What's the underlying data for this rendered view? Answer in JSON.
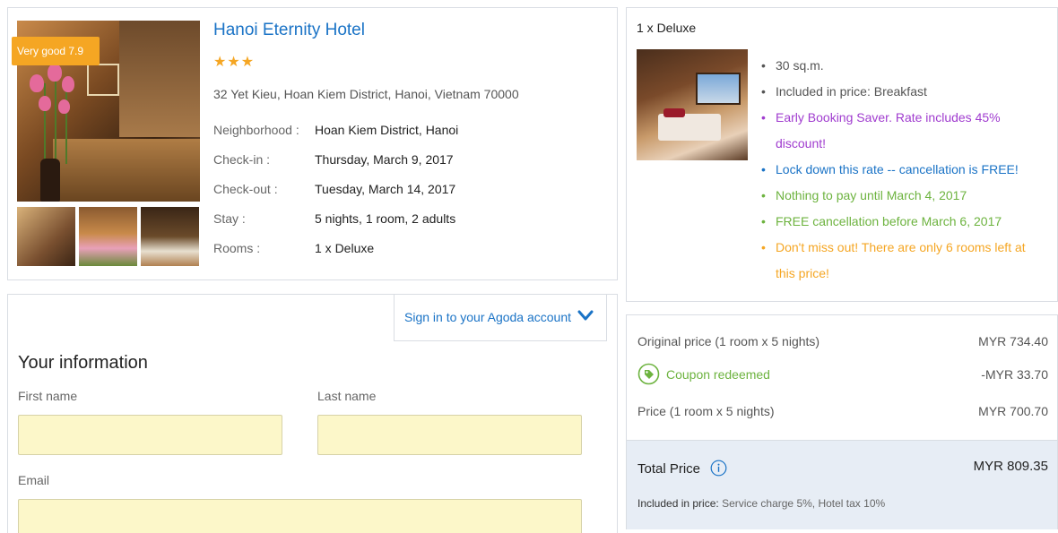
{
  "hotel": {
    "score_badge": "Very good 7.9",
    "name": "Hanoi Eternity Hotel",
    "stars": "★★★",
    "star_rating": 3,
    "address": "32 Yet Kieu, Hoan Kiem District, Hanoi, Vietnam 70000",
    "details": [
      {
        "label": "Neighborhood :",
        "value": "Hoan Kiem District, Hanoi"
      },
      {
        "label": "Check-in :",
        "value": "Thursday, March 9, 2017"
      },
      {
        "label": "Check-out :",
        "value": "Tuesday, March 14, 2017"
      },
      {
        "label": "Stay :",
        "value": "5 nights, 1 room, 2 adults"
      },
      {
        "label": "Rooms :",
        "value": "1 x Deluxe"
      }
    ]
  },
  "room": {
    "title": "1 x Deluxe",
    "features": [
      {
        "text": "30 sq.m.",
        "color": "#555555"
      },
      {
        "text": "Included in price: Breakfast",
        "color": "#555555"
      },
      {
        "text": "Early Booking Saver. Rate includes 45% discount!",
        "color": "#a03ccf"
      },
      {
        "text": "Lock down this rate -- cancellation is FREE!",
        "color": "#1a73c6"
      },
      {
        "text": "Nothing to pay until March 4, 2017",
        "color": "#6db33f"
      },
      {
        "text": "FREE cancellation before March 6, 2017",
        "color": "#6db33f"
      },
      {
        "text": "Don't miss out! There are only 6 rooms left at this price!",
        "color": "#f5a623"
      }
    ]
  },
  "form": {
    "signin_label": "Sign in to your Agoda account",
    "title": "Your information",
    "first_name_label": "First name",
    "last_name_label": "Last name",
    "email_label": "Email",
    "first_name_value": "",
    "last_name_value": "",
    "email_value": ""
  },
  "price": {
    "original_label": "Original price (1 room x 5 nights)",
    "original_value": "MYR 734.40",
    "coupon_label": "Coupon redeemed",
    "coupon_value": "-MYR 33.70",
    "price_label": "Price (1 room x 5 nights)",
    "price_value": "MYR 700.70",
    "total_label": "Total Price",
    "total_value": "MYR 809.35",
    "included_label": "Included in price:",
    "included_value": " Service charge 5%, Hotel tax 10%"
  },
  "colors": {
    "link": "#1a73c6",
    "badge": "#f5a623",
    "green": "#6db33f",
    "purple": "#a03ccf",
    "orange": "#f5a623",
    "input_bg": "#fcf7c9",
    "total_bg": "#e7edf5"
  }
}
